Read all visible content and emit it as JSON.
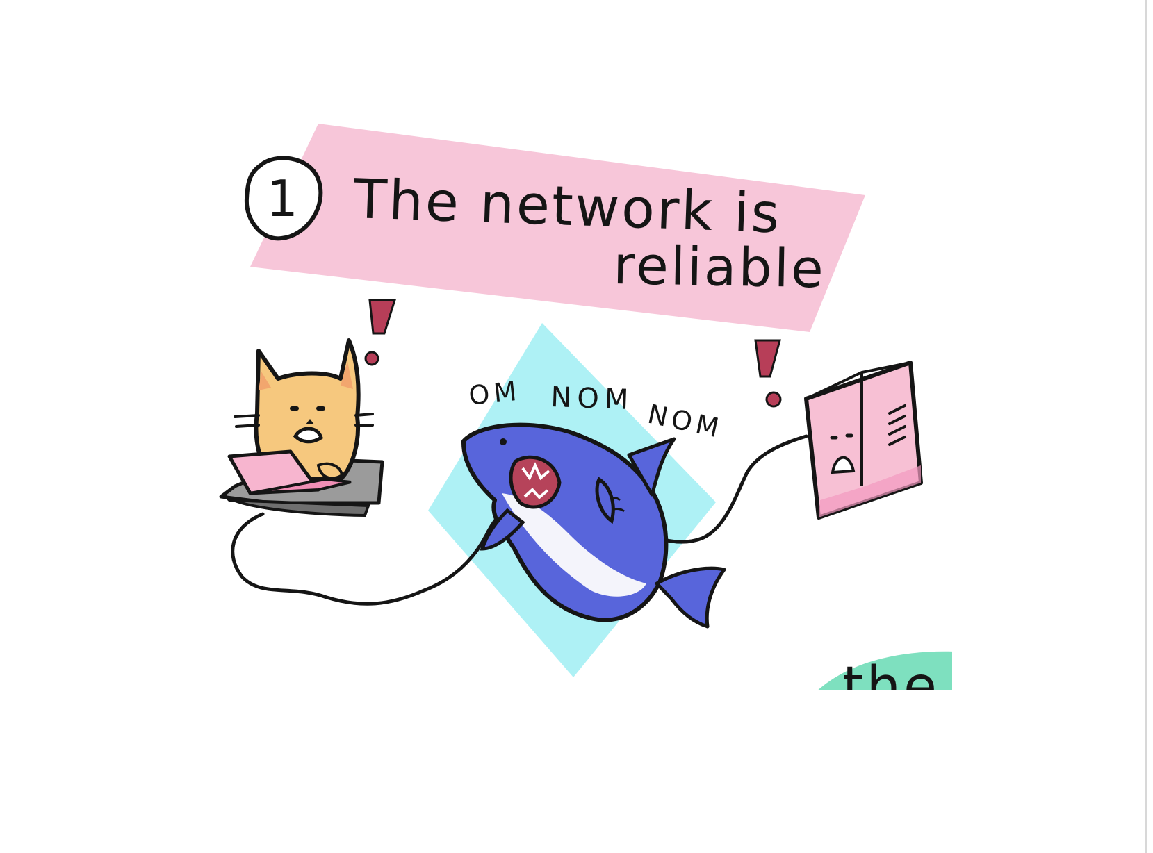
{
  "panel": {
    "number": "1",
    "title_line1": "The network is",
    "title_line2": "reliable"
  },
  "sound_effect": {
    "words": [
      "OM",
      "NOM",
      "NOM"
    ]
  },
  "cropped_text": "the",
  "icons": {
    "cat": "cat-typing-icon",
    "laptop": "laptop-icon",
    "shark": "shark-icon",
    "server": "server-icon",
    "alarm": "exclamation-icon"
  },
  "colors": {
    "title_band": "#f7c6d9",
    "diamond": "#aef1f5",
    "cat": "#f6c87e",
    "laptop": "#f7b5cf",
    "shark": "#5865db",
    "server": "#f7c0d4",
    "exclamation": "#b73e58",
    "corner_blob": "#7ee0bf"
  }
}
